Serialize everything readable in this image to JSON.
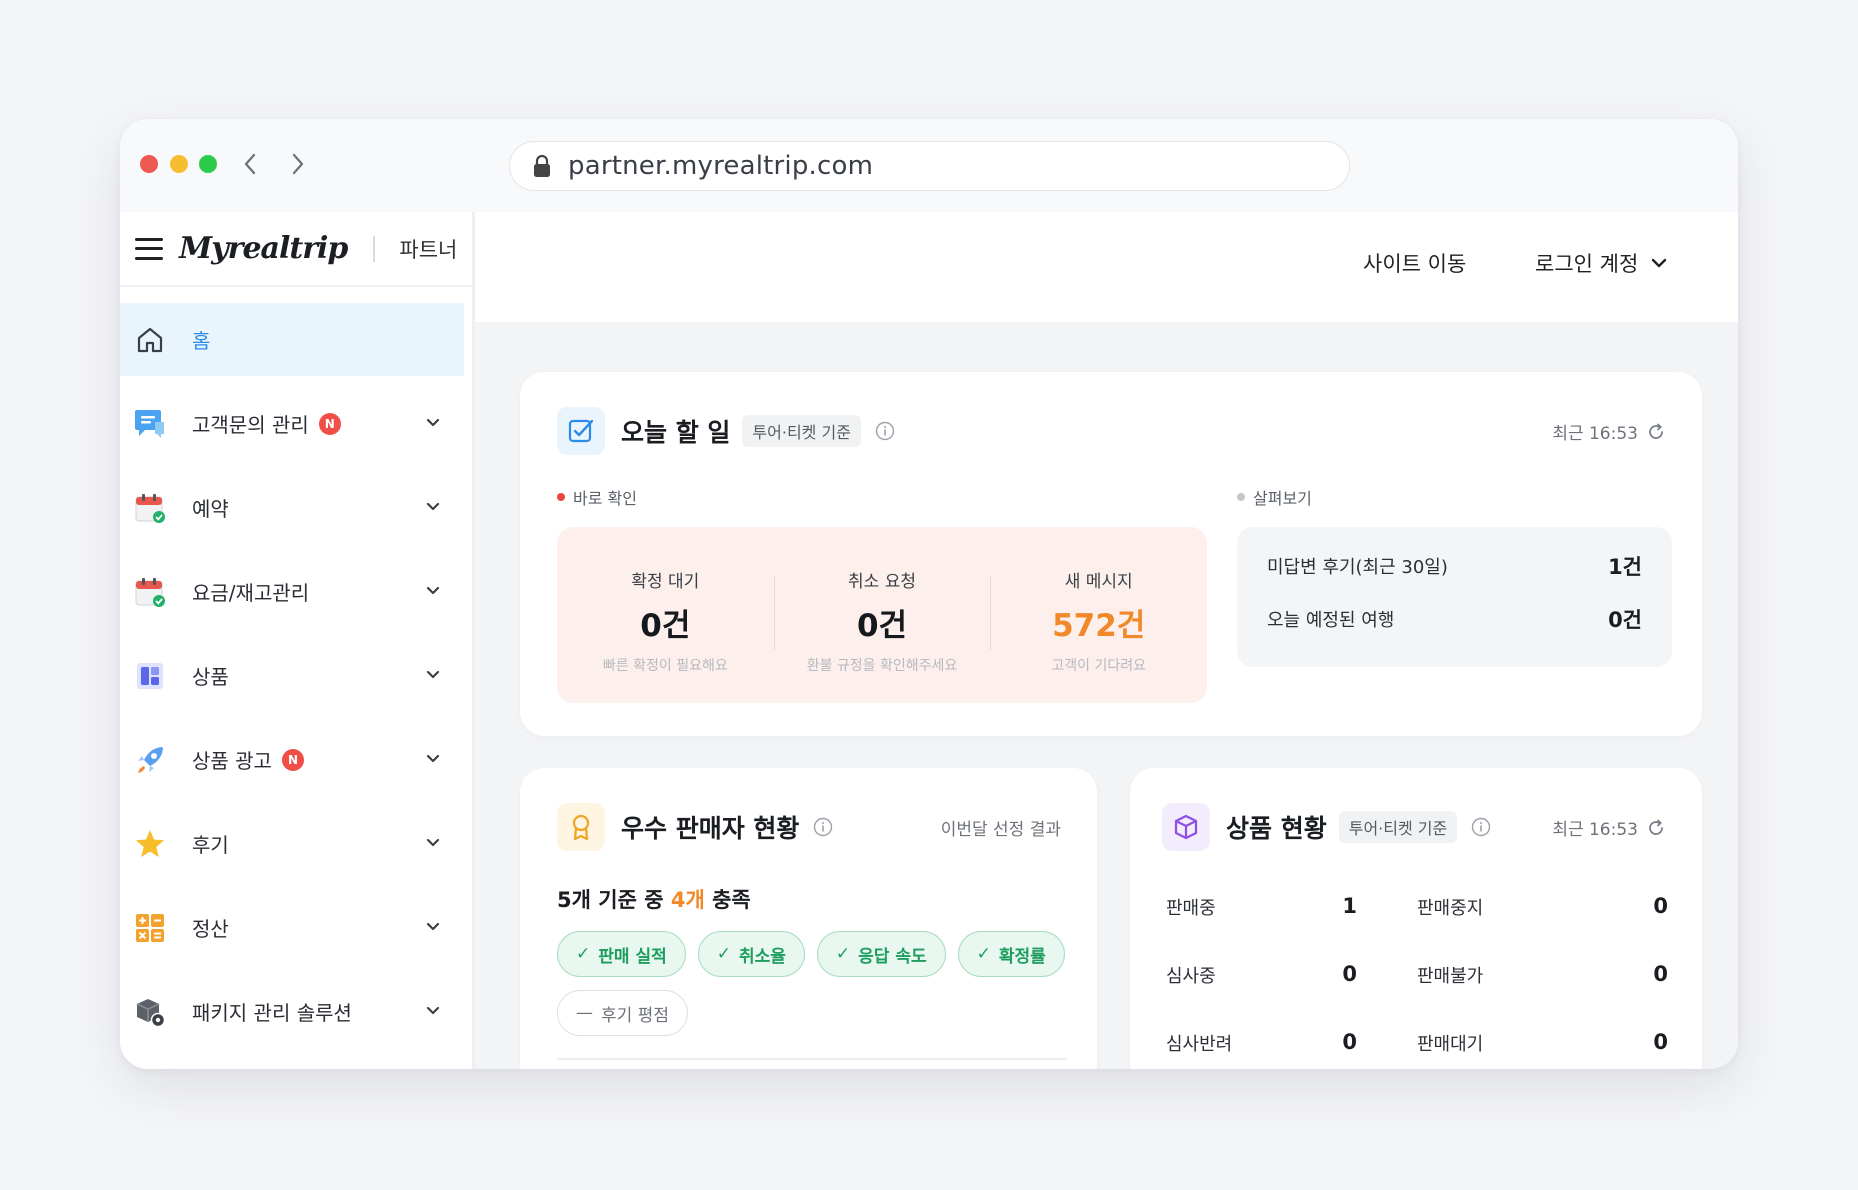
{
  "browser": {
    "url": "partner.myrealtrip.com"
  },
  "sidebar": {
    "logo": "Myrealtrip",
    "partner_label": "파트너",
    "items": [
      {
        "label": "홈",
        "icon": "home-icon",
        "active": true,
        "badge": "",
        "chevron": false
      },
      {
        "label": "고객문의 관리",
        "icon": "chat-icon",
        "badge": "N",
        "chevron": true
      },
      {
        "label": "예약",
        "icon": "calendar-check-icon",
        "badge": "",
        "chevron": true
      },
      {
        "label": "요금/재고관리",
        "icon": "calendar-check-icon",
        "badge": "",
        "chevron": true
      },
      {
        "label": "상품",
        "icon": "product-grid-icon",
        "badge": "",
        "chevron": true
      },
      {
        "label": "상품 광고",
        "icon": "rocket-icon",
        "badge": "N",
        "chevron": true
      },
      {
        "label": "후기",
        "icon": "star-icon",
        "badge": "",
        "chevron": true
      },
      {
        "label": "정산",
        "icon": "calculator-icon",
        "badge": "",
        "chevron": true
      },
      {
        "label": "패키지 관리 솔루션",
        "icon": "package-gear-icon",
        "badge": "",
        "chevron": true
      }
    ]
  },
  "header": {
    "site_link": "사이트 이동",
    "login_account": "로그인 계정"
  },
  "today": {
    "title": "오늘 할 일",
    "tag": "투어·티켓 기준",
    "refresh": "최근 16:53",
    "urgent_label": "바로 확인",
    "glance_label": "살펴보기",
    "urgent": [
      {
        "label": "확정 대기",
        "value": "0건",
        "sub": "빠른 확정이 필요해요"
      },
      {
        "label": "취소 요청",
        "value": "0건",
        "sub": "환불 규정을 확인해주세요"
      },
      {
        "label": "새 메시지",
        "value": "572건",
        "sub": "고객이 기다려요"
      }
    ],
    "glance": [
      {
        "label": "미답변 후기(최근 30일)",
        "value": "1건"
      },
      {
        "label": "오늘 예정된 여행",
        "value": "0건"
      }
    ]
  },
  "seller": {
    "title": "우수 판매자 현황",
    "subtitle": "이번달 선정 결과",
    "summary_prefix": "5개 기준 중 ",
    "summary_highlight": "4개",
    "summary_suffix": " 충족",
    "chips": [
      {
        "label": "판매 실적",
        "met": true
      },
      {
        "label": "취소율",
        "met": true
      },
      {
        "label": "응답 속도",
        "met": true
      },
      {
        "label": "확정률",
        "met": true
      },
      {
        "label": "후기 평점",
        "met": false
      }
    ]
  },
  "product_status": {
    "title": "상품 현황",
    "tag": "투어·티켓 기준",
    "refresh": "최근 16:53",
    "rows": [
      [
        {
          "label": "판매중",
          "value": "1"
        },
        {
          "label": "판매중지",
          "value": "0"
        }
      ],
      [
        {
          "label": "심사중",
          "value": "0"
        },
        {
          "label": "판매불가",
          "value": "0"
        }
      ],
      [
        {
          "label": "심사반려",
          "value": "0"
        },
        {
          "label": "판매대기",
          "value": "0"
        }
      ]
    ]
  },
  "colors": {
    "accent_blue": "#2b8be6",
    "orange": "#f1892a",
    "green": "#1e9e5e",
    "badge_red": "#ef4f46"
  }
}
